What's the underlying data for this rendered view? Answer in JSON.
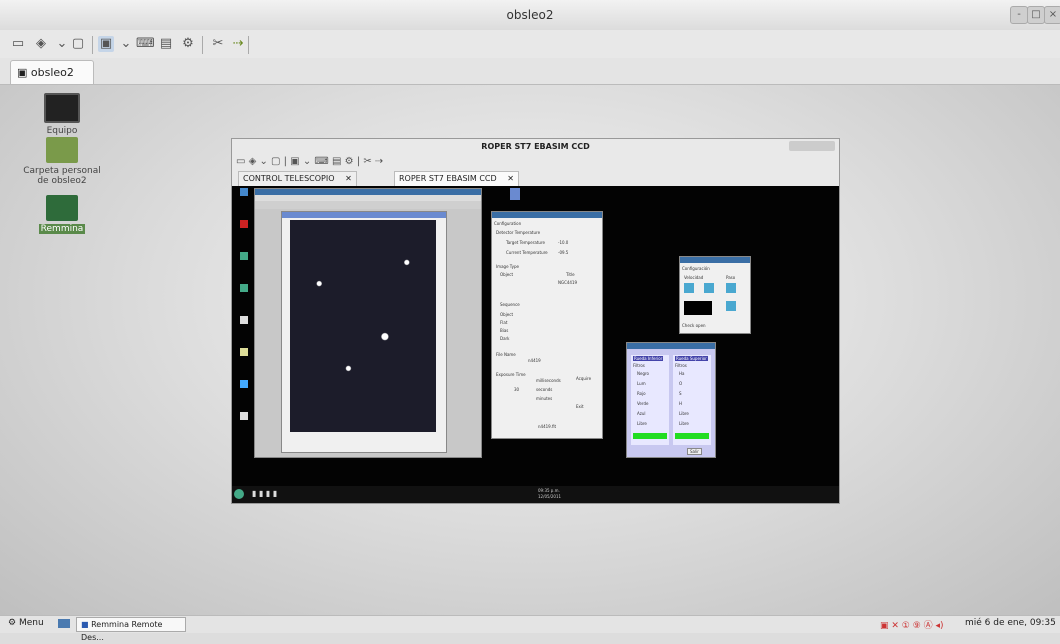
{
  "window": {
    "title": "obsleo2",
    "controls": [
      "-",
      "□",
      "×"
    ]
  },
  "toolbar": {
    "icons": [
      "screen-icon",
      "pin-icon",
      "chevron-down-icon",
      "window-icon",
      "scale-icon",
      "chevron-down-icon",
      "keyboard-icon",
      "vnc-icon",
      "settings-icon",
      "screenshot-icon",
      "disconnect-icon"
    ]
  },
  "tab": {
    "label": "obsleo2",
    "close": "✕"
  },
  "desktop": {
    "icons": [
      {
        "label": "Equipo"
      },
      {
        "label": "Carpeta personal de obsleo2"
      },
      {
        "label": "Remmina"
      }
    ]
  },
  "inner": {
    "title": "ROPER ST7 EBASIM CCD",
    "tabs": [
      {
        "label": "CONTROL TELESCOPIO",
        "close": "✕"
      },
      {
        "label": "ROPER ST7 EBASIM CCD",
        "close": "✕"
      }
    ]
  },
  "camera": {
    "config_title": "Configuration",
    "detector_temp": "Detector Temperature",
    "target_temp": "Target Temperature",
    "target_val": "-10.0",
    "current_temp": "Current Temperature",
    "current_val": "-09.5",
    "image_type": "Image Type",
    "object": "Object",
    "title_label": "Title",
    "title_val": "NGC4419",
    "sequence": "Sequence",
    "opts": [
      "Object",
      "Flat",
      "Bias",
      "Dark"
    ],
    "filename": "File Name",
    "filename_val": "n4419",
    "exposure": "Exposure Time",
    "units": [
      "milliseconds",
      "seconds",
      "minutes"
    ],
    "exp_val": "30",
    "acquire": "Acquire",
    "exit": "Exit",
    "status_val": "n4419.fit"
  },
  "focus": {
    "title": "Configuración",
    "velocidad": "Velocidad",
    "paso": "Paso",
    "status": "Check open"
  },
  "filters": {
    "col1": "Rueda Inferior",
    "col2": "Rueda Superior",
    "filtros": "Filtros",
    "f1": [
      "Negro",
      "Lum",
      "Rojo",
      "Verde",
      "Azul",
      "Libre"
    ],
    "f2": [
      "Ha",
      "O",
      "S",
      "H",
      "Libre",
      "Libre"
    ],
    "exit": "Salir"
  },
  "remote_taskbar": {
    "time": "09:35 p.m.",
    "date": "12/05/2011"
  },
  "taskbar": {
    "menu": "Menu",
    "task": "Remmina Remote Des...",
    "clock": "mié  6 de ene, 09:35"
  }
}
